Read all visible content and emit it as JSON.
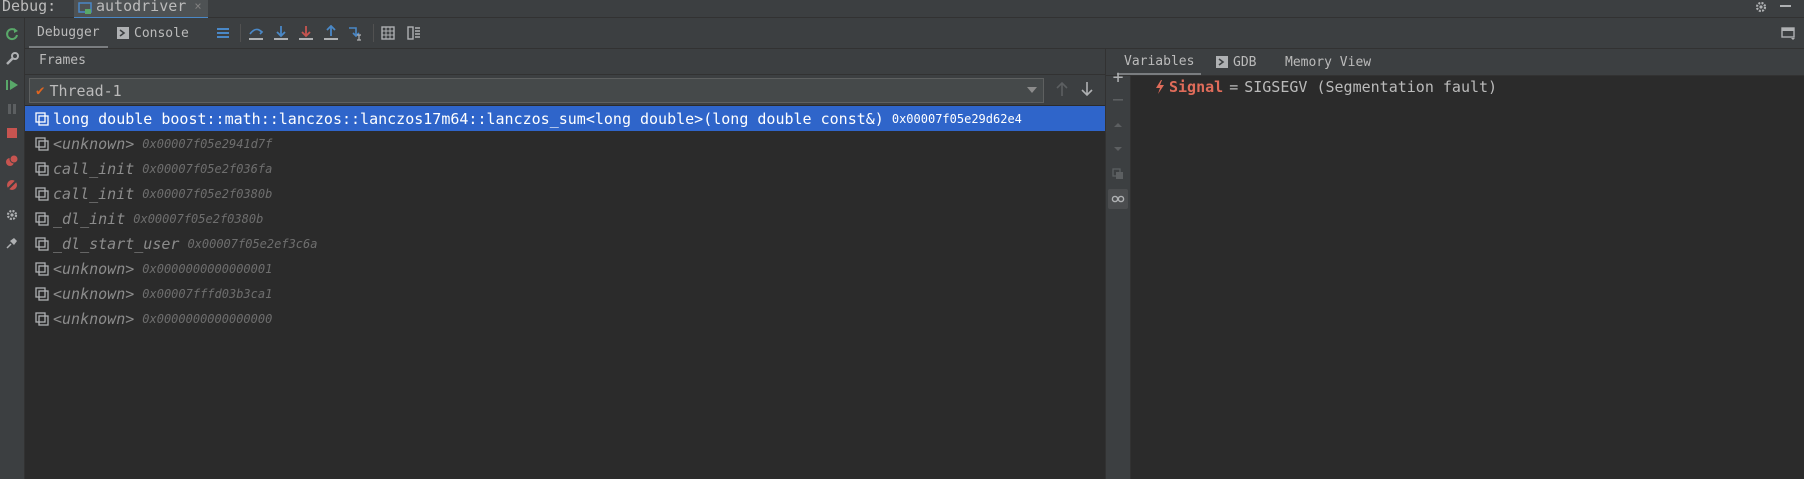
{
  "title_bar": {
    "label": "Debug:",
    "tab_name": "autodriver",
    "tab_close": "×"
  },
  "toolbar": {
    "tab_debugger": "Debugger",
    "tab_console": "Console"
  },
  "frames": {
    "header": "Frames",
    "thread": "Thread-1",
    "items": [
      {
        "name": "long double boost::math::lanczos::lanczos17m64::lanczos_sum<long double>(long double const&)",
        "addr": "0x00007f05e29d62e4",
        "selected": true
      },
      {
        "name": "<unknown>",
        "addr": "0x00007f05e2941d7f"
      },
      {
        "name": "call_init",
        "addr": "0x00007f05e2f036fa"
      },
      {
        "name": "call_init",
        "addr": "0x00007f05e2f0380b"
      },
      {
        "name": "_dl_init",
        "addr": "0x00007f05e2f0380b"
      },
      {
        "name": "_dl_start_user",
        "addr": "0x00007f05e2ef3c6a"
      },
      {
        "name": "<unknown>",
        "addr": "0x0000000000000001"
      },
      {
        "name": "<unknown>",
        "addr": "0x00007fffd03b3ca1"
      },
      {
        "name": "<unknown>",
        "addr": "0x0000000000000000"
      }
    ]
  },
  "variables": {
    "tab_variables": "Variables",
    "tab_gdb": "GDB",
    "tab_memory": "Memory View",
    "signal_name": "Signal",
    "signal_eq": "=",
    "signal_value": "SIGSEGV (Segmentation fault)"
  },
  "colors": {
    "background": "#3c3f41",
    "panel": "#2b2b2b",
    "selection": "#2f65ca",
    "error": "#e06c5a",
    "accent": "#4a88c7"
  }
}
